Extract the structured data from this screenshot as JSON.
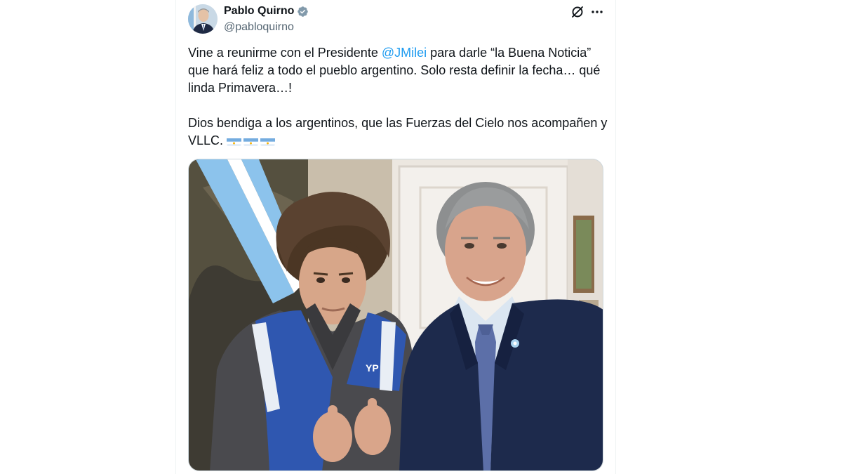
{
  "author": {
    "display_name": "Pablo Quirno",
    "handle": "@pabloquirno",
    "verified": true
  },
  "tweet": {
    "paragraph1": {
      "before_mention": "Vine a reunirme con el Presidente ",
      "mention": "@JMilei",
      "after_mention": " para darle “la Buena Noticia” que hará feliz a todo el pueblo argentino. Solo resta definir la fecha… qué linda Primavera…!"
    },
    "paragraph2": {
      "text": "Dios bendiga a los argentinos, que las Fuerzas del  Cielo nos acompañen y VLLC. "
    },
    "emoji_flags": [
      "argentina-flag",
      "argentina-flag",
      "argentina-flag"
    ]
  },
  "media": {
    "jacket_logo_text": "YP"
  },
  "icons": {
    "verified": "verified-badge-icon",
    "grok": "grok-icon",
    "more": "more-options-icon"
  },
  "colors": {
    "text_primary": "#0f1419",
    "text_secondary": "#536471",
    "link": "#1d9bf0",
    "verified": "#829aab",
    "border": "#eff3f4"
  }
}
